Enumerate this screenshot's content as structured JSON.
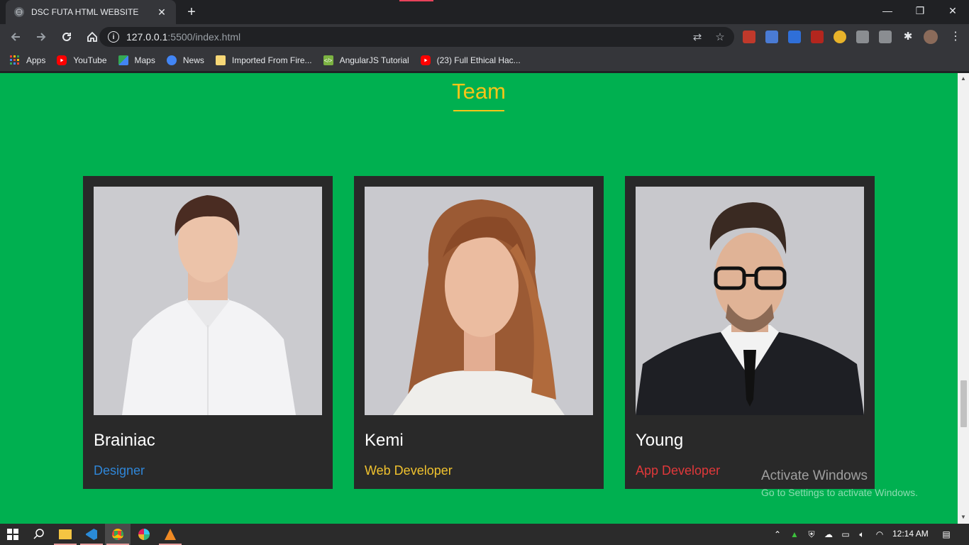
{
  "browser": {
    "tab_title": "DSC FUTA HTML WEBSITE",
    "url_host": "127.0.0.1",
    "url_path": ":5500/index.html",
    "bookmarks": [
      {
        "label": "Apps",
        "icon": "apps-grid-icon"
      },
      {
        "label": "YouTube",
        "icon": "youtube-icon"
      },
      {
        "label": "Maps",
        "icon": "maps-icon"
      },
      {
        "label": "News",
        "icon": "news-icon"
      },
      {
        "label": "Imported From Fire...",
        "icon": "folder-icon"
      },
      {
        "label": "AngularJS Tutorial",
        "icon": "angular-icon"
      },
      {
        "label": "(23) Full Ethical Hac...",
        "icon": "youtube-icon"
      }
    ]
  },
  "page": {
    "heading": "Team",
    "colors": {
      "background": "#00b050",
      "heading": "#f5c518",
      "card": "#292929"
    },
    "members": [
      {
        "name": "Brainiac",
        "role": "Designer",
        "role_color": "#2f86d8"
      },
      {
        "name": "Kemi",
        "role": "Web Developer",
        "role_color": "#f0c22e"
      },
      {
        "name": "Young",
        "role": "App Developer",
        "role_color": "#e0383a"
      }
    ]
  },
  "watermark": {
    "line1": "Activate Windows",
    "line2": "Go to Settings to activate Windows."
  },
  "taskbar": {
    "time": "12:14 AM"
  }
}
